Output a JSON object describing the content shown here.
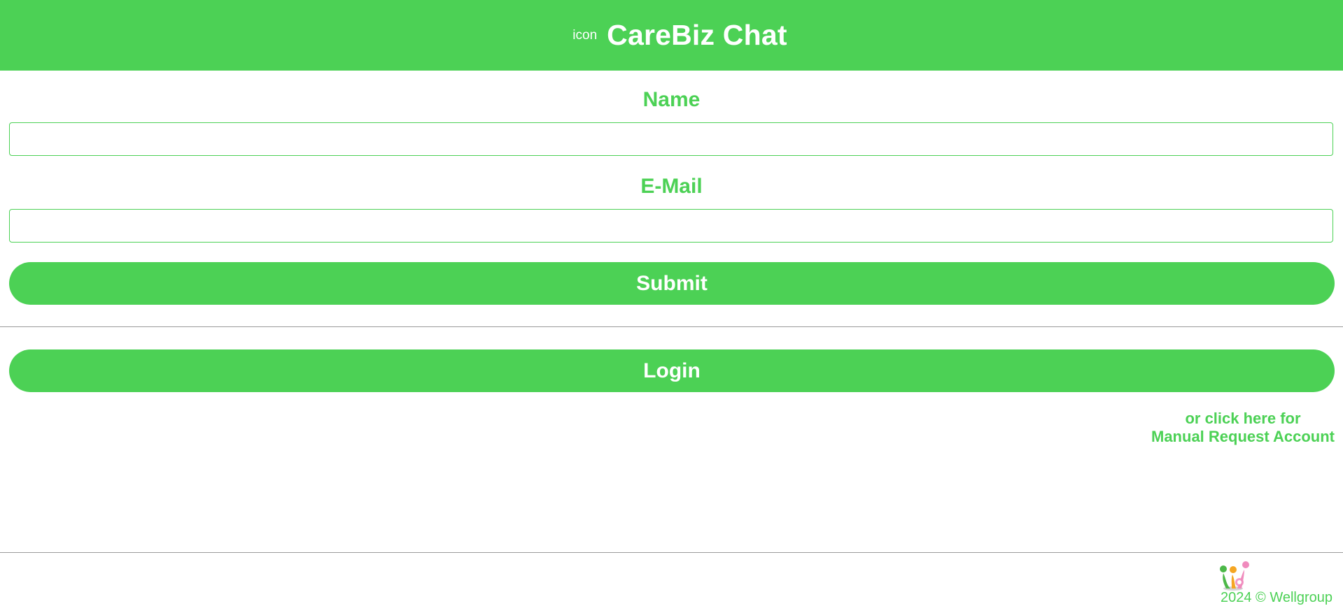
{
  "header": {
    "icon_alt": "icon",
    "title": "CareBiz Chat"
  },
  "form": {
    "name_label": "Name",
    "name_value": "",
    "email_label": "E-Mail",
    "email_value": "",
    "submit_label": "Submit"
  },
  "login": {
    "login_label": "Login",
    "manual_line1": "or click here for",
    "manual_line2": "Manual Request Account"
  },
  "footer": {
    "copyright": "2024 © Wellgroup"
  },
  "colors": {
    "brand_green": "#4cd155",
    "divider": "#9a9a9a",
    "logo_green": "#4cb848",
    "logo_orange": "#f5a623",
    "logo_pink": "#f08bbd"
  },
  "icons": {
    "header": "broken-image-icon",
    "footer": "wellgroup-logo-icon"
  }
}
